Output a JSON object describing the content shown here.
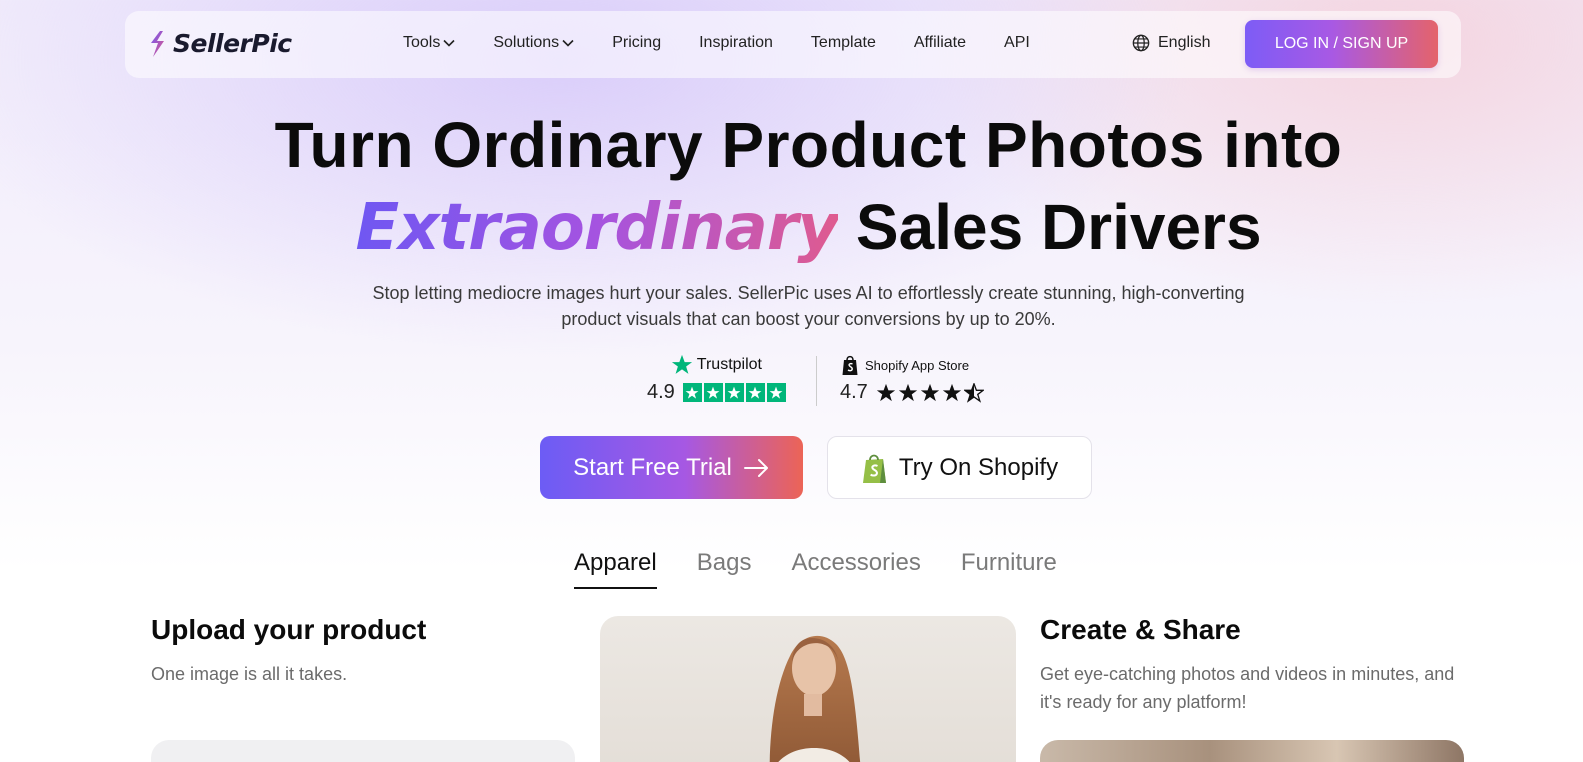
{
  "brand": {
    "name": "SellerPic",
    "accent_start": "#6f57f2",
    "accent_end": "#ec6456"
  },
  "nav": {
    "items": [
      {
        "label": "Tools",
        "has_dropdown": true
      },
      {
        "label": "Solutions",
        "has_dropdown": true
      },
      {
        "label": "Pricing",
        "has_dropdown": false
      },
      {
        "label": "Inspiration",
        "has_dropdown": false
      },
      {
        "label": "Template",
        "has_dropdown": false
      },
      {
        "label": "Affiliate",
        "has_dropdown": false
      },
      {
        "label": "API",
        "has_dropdown": false
      }
    ],
    "language": "English",
    "login_label": "LOG IN / SIGN UP"
  },
  "hero": {
    "line1": "Turn Ordinary Product Photos into",
    "accent": "Extraordinary",
    "line2_rest": "Sales Drivers",
    "subtitle_line1": "Stop letting mediocre images hurt your sales. SellerPic uses AI to effortlessly create stunning, high-converting",
    "subtitle_line2": "product visuals that can boost your conversions by up to 20%."
  },
  "ratings": {
    "trustpilot": {
      "name": "Trustpilot",
      "score": "4.9",
      "stars": 5
    },
    "shopify": {
      "name": "Shopify App Store",
      "score": "4.7",
      "stars": 4.5
    }
  },
  "cta": {
    "primary": "Start Free Trial",
    "secondary": "Try On Shopify"
  },
  "tabs": [
    {
      "label": "Apparel",
      "active": true
    },
    {
      "label": "Bags",
      "active": false
    },
    {
      "label": "Accessories",
      "active": false
    },
    {
      "label": "Furniture",
      "active": false
    }
  ],
  "steps": {
    "upload": {
      "title": "Upload your product",
      "text": "One image is all it takes."
    },
    "share": {
      "title": "Create & Share",
      "text_line1": "Get eye-catching photos and videos in minutes, and",
      "text_line2": "it's ready for any platform!"
    }
  }
}
